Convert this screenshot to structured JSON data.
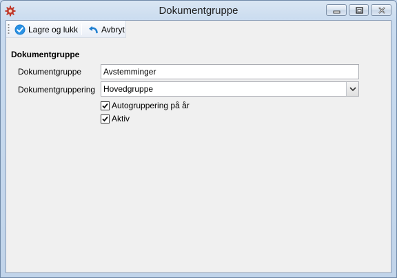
{
  "window": {
    "title": "Dokumentgruppe",
    "icon": "gear-app-icon",
    "controls": [
      "minimize",
      "maximize",
      "close"
    ]
  },
  "toolbar": {
    "save_label": "Lagre og lukk",
    "save_icon": "checkmark-circle-icon",
    "cancel_label": "Avbryt",
    "cancel_icon": "undo-arrow-icon"
  },
  "form": {
    "section_title": "Dokumentgruppe",
    "group_label": "Dokumentgruppe",
    "group_value": "Avstemminger",
    "grouping_label": "Dokumentgruppering",
    "grouping_value": "Hovedgruppe",
    "autogroup_label": "Autogruppering på år",
    "autogroup_checked": true,
    "active_label": "Aktiv",
    "active_checked": true
  },
  "colors": {
    "accent": "#1f7fd0",
    "app_icon": "#c0392b",
    "frame": "#c6d8ee"
  }
}
